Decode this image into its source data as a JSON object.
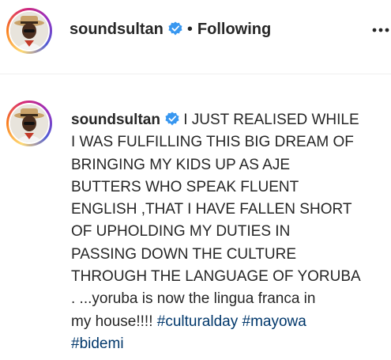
{
  "header": {
    "username": "soundsultan",
    "separator": "•",
    "follow_status": "Following"
  },
  "post": {
    "username": "soundsultan",
    "caption_lines": [
      "I JUST REALISED WHILE",
      "I WAS FULFILLING THIS BIG DREAM OF",
      "BRINGING MY KIDS UP AS AJE",
      "BUTTERS WHO SPEAK FLUENT",
      "ENGLISH ,THAT I HAVE FALLEN SHORT",
      "OF UPHOLDING MY DUTIES IN",
      "PASSING DOWN THE CULTURE",
      "THROUGH THE LANGUAGE OF YORUBA",
      ". ...yoruba is now the lingua franca in",
      "my house!!!!"
    ],
    "hashtags": [
      "#culturalday",
      "#mayowa",
      "#bidemi"
    ]
  },
  "colors": {
    "text": "#262626",
    "hashtag": "#00376b",
    "verified": "#3897f0",
    "divider": "#efefef"
  },
  "icons": {
    "verified": "verified-badge-icon",
    "more": "more-options-icon"
  }
}
